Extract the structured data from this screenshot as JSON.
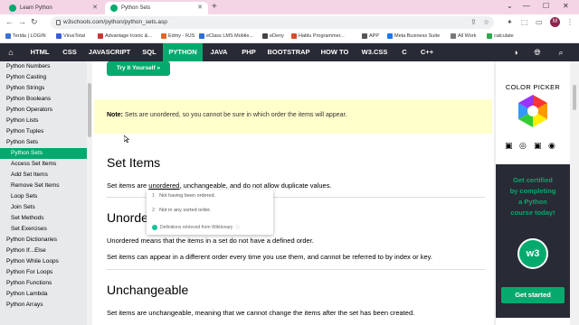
{
  "browser": {
    "tabs": [
      {
        "label": "Learn Python",
        "active": false,
        "favicon_color": "#04aa6d"
      },
      {
        "label": "Python Sets",
        "active": true,
        "favicon_color": "#04aa6d"
      }
    ],
    "new_tab": "+",
    "url": "w3schools.com/python/python_sets.asp",
    "avatar_letter": "M",
    "bookmarks": [
      {
        "label": "Terida | LOGIN",
        "color": "#3b6fd8"
      },
      {
        "label": "VirusTotal",
        "color": "#3a5bd8"
      },
      {
        "label": "Advantage Iconic &...",
        "color": "#cc3333"
      },
      {
        "label": "Edmy - RJS",
        "color": "#e0662a"
      },
      {
        "label": "eClass LMS Mobile...",
        "color": "#2a6ed8"
      },
      {
        "label": "eDeny",
        "color": "#444444"
      },
      {
        "label": "Hablu Programmer...",
        "color": "#d84a2a"
      },
      {
        "label": "APP",
        "color": "#555555"
      },
      {
        "label": "Meta Business Suite",
        "color": "#1877f2"
      },
      {
        "label": "All Work",
        "color": "#777777"
      },
      {
        "label": "calculate",
        "color": "#2aa84a"
      }
    ]
  },
  "nav": {
    "items": [
      "HTML",
      "CSS",
      "JAVASCRIPT",
      "SQL",
      "PYTHON",
      "JAVA",
      "PHP",
      "BOOTSTRAP",
      "HOW TO",
      "W3.CSS",
      "C",
      "C++"
    ],
    "active": "PYTHON",
    "accent": "#04aa6d",
    "bg": "#282a35"
  },
  "sidebar": {
    "items": [
      {
        "label": "Python Numbers"
      },
      {
        "label": "Python Casting"
      },
      {
        "label": "Python Strings"
      },
      {
        "label": "Python Booleans"
      },
      {
        "label": "Python Operators"
      },
      {
        "label": "Python Lists"
      },
      {
        "label": "Python Tuples"
      },
      {
        "label": "Python Sets"
      },
      {
        "label": "Python Sets"
      },
      {
        "label": "Access Set Items"
      },
      {
        "label": "Add Set Items"
      },
      {
        "label": "Remove Set Items"
      },
      {
        "label": "Loop Sets"
      },
      {
        "label": "Join Sets"
      },
      {
        "label": "Set Methods"
      },
      {
        "label": "Set Exercises"
      },
      {
        "label": "Python Dictionaries"
      },
      {
        "label": "Python If...Else"
      },
      {
        "label": "Python While Loops"
      },
      {
        "label": "Python For Loops"
      },
      {
        "label": "Python Functions"
      },
      {
        "label": "Python Lambda"
      },
      {
        "label": "Python Arrays"
      }
    ]
  },
  "main": {
    "try_it": "Try It Yourself »",
    "note_label": "Note:",
    "note_text": " Sets are unordered, so you cannot be sure in which order the items will appear.",
    "sections": {
      "set_items_title": "Set Items",
      "set_items_p_pre": "Set items are ",
      "set_items_p_link": "unordered",
      "set_items_p_post": ", unchangeable, and do not allow duplicate values.",
      "unordered_title": "Unordered",
      "unordered_p1": "Unordered means that the items in a set do not have a defined order.",
      "unordered_p2": "Set items can appear in a different order every time you use them, and cannot be referred to by index or key.",
      "unchangeable_title": "Unchangeable",
      "unchangeable_p": "Set items are unchangeable, meaning that we cannot change the items after the set has been created."
    },
    "definition_popup": {
      "defs": [
        {
          "num": "1",
          "text": "Not having been ordered."
        },
        {
          "num": "2",
          "text": "Not in any sorted order."
        }
      ],
      "source": "Definitions retrieved from Wiktionary"
    }
  },
  "right": {
    "color_picker": "COLOR PICKER",
    "ad_text": "Get certified\nby completing\na Python\ncourse today!",
    "badge": "w3",
    "ad_button": "Get started"
  }
}
